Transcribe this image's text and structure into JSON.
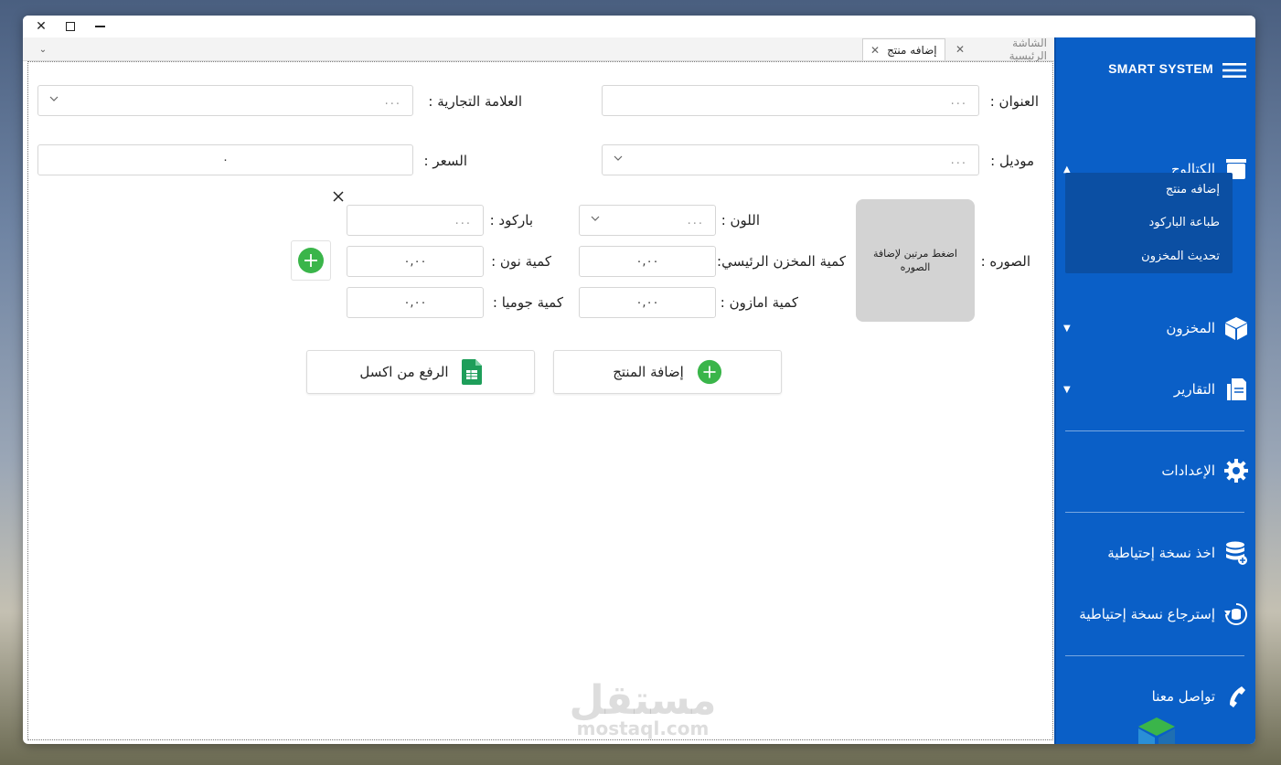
{
  "tabs": [
    {
      "label": "الشاشة الرئيسية",
      "active": false
    },
    {
      "label": "إضافه منتج",
      "active": true
    }
  ],
  "form": {
    "title_label": "العنوان :",
    "title_placeholder": "...",
    "brand_label": "العلامة التجارية :",
    "brand_placeholder": "...",
    "model_label": "موديل :",
    "model_placeholder": "...",
    "price_label": "السعر :",
    "price_value": "٠",
    "image_label": "الصوره :",
    "image_hint": "اضغط مرتين لإضافة الصوره",
    "color_label": "اللون :",
    "color_placeholder": "...",
    "barcode_label": "باركود :",
    "barcode_placeholder": "...",
    "main_stock_label": "كمية المخزن الرئيسي:",
    "main_stock_value": "٠,٠٠",
    "noon_label": "كمية نون :",
    "noon_value": "٠,٠٠",
    "amazon_label": "كمية امازون :",
    "amazon_value": "٠,٠٠",
    "jumia_label": "كمية جوميا :",
    "jumia_value": "٠,٠٠",
    "add_product_label": "إضافة المنتج",
    "excel_upload_label": "الرفع من اكسل"
  },
  "sidebar": {
    "title": "SMART SYSTEM",
    "catalog": "الكتالوج",
    "catalog_items": [
      "إضافه منتج",
      "طباعة الباركود",
      "تحديث المخزون"
    ],
    "inventory": "المخزون",
    "reports": "التقارير",
    "settings": "الإعدادات",
    "backup": "اخذ نسخة إحتياطية",
    "restore": "إسترجاع نسخة إحتياطية",
    "contact": "تواصل معنا"
  },
  "watermark": {
    "ar": "مستقل",
    "en": "mostaql.com"
  },
  "colors": {
    "sidebar": "#0a5fc7",
    "submenu": "#0b4fa3",
    "accent_green": "#3ab54a"
  }
}
